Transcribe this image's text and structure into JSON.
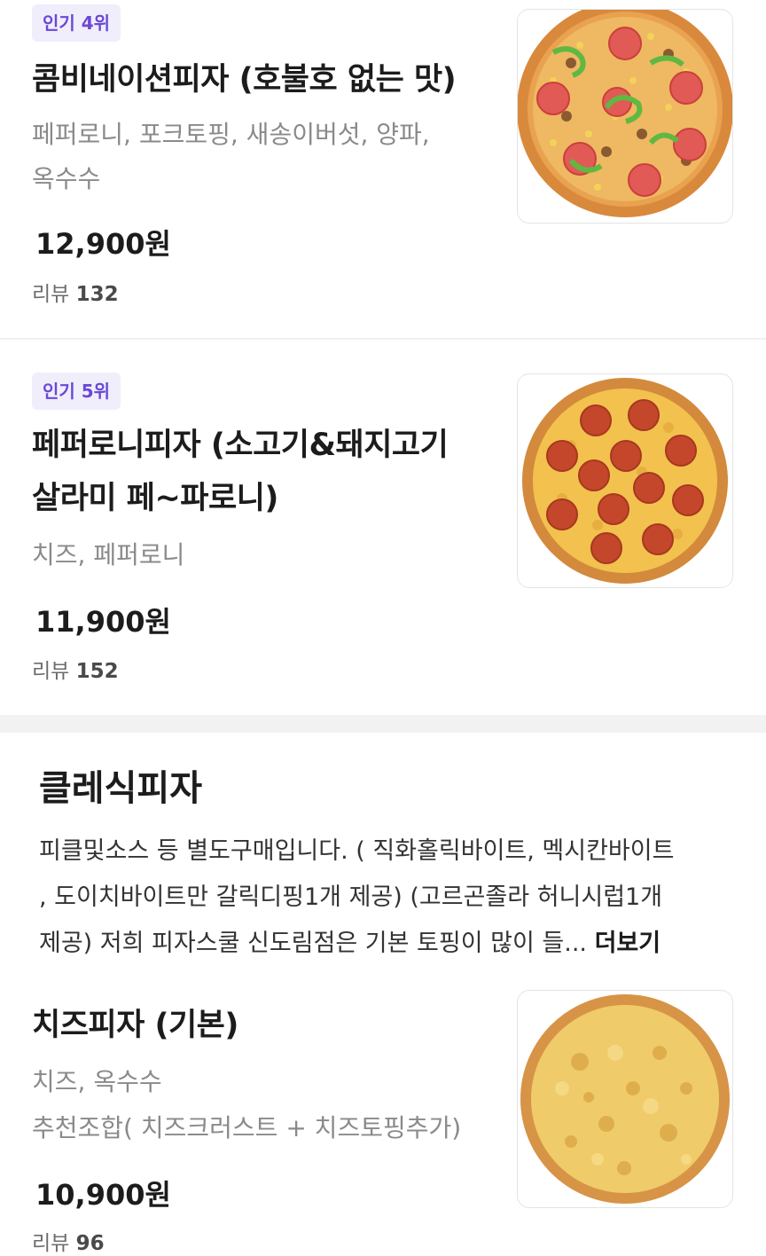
{
  "items": [
    {
      "badge": "인기 4위",
      "name_line1": "콤비네이션피자 (호불호 없는 맛)",
      "name_line2": "",
      "desc_line1": "페퍼로니, 포크토핑, 새송이버섯, 양파,",
      "desc_line2": "옥수수",
      "price": "12,900원",
      "review_label": "리뷰",
      "review_count": "132"
    },
    {
      "badge": "인기 5위",
      "name_line1": "페퍼로니피자 (소고기&돼지고기",
      "name_line2": "살라미 페~파로니)",
      "desc_line1": "치즈, 페퍼로니",
      "price": "11,900원",
      "review_label": "리뷰",
      "review_count": "152"
    },
    {
      "name_line1": "치즈피자 (기본)",
      "desc_line1": "치즈, 옥수수",
      "desc_line2": "추천조합( 치즈크러스트 + 치즈토핑추가)",
      "price": "10,900원",
      "review_label": "리뷰",
      "review_count": "96"
    }
  ],
  "section": {
    "title": "클레식피자",
    "desc_line1": "피클및소스 등 별도구매입니다. ( 직화홀릭바이트, 멕시칸바이트",
    "desc_line2": ", 도이치바이트만 갈릭디핑1개 제공) (고르곤졸라 허니시럽1개",
    "desc_line3": "제공) 저희 피자스쿨 신도림점은 기본 토핑이 많이 들...",
    "more_label": "더보기"
  }
}
